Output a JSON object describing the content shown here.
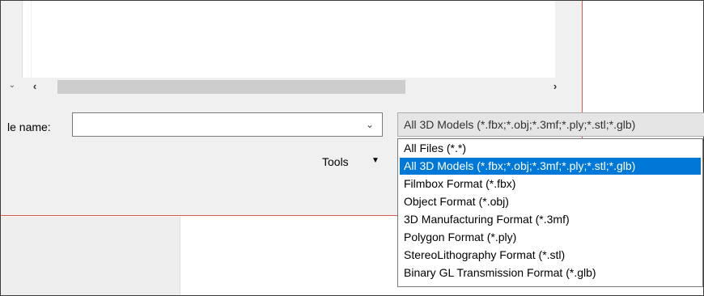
{
  "dialog": {
    "file_name_label": "le name:",
    "file_name_value": "",
    "file_type_selected": "All 3D Models (*.fbx;*.obj;*.3mf;*.ply;*.stl;*.glb)",
    "tools_label": "Tools"
  },
  "icons": {
    "tree_expand": "chevron-down-icon",
    "scroll_left": "scroll-left-arrow-icon",
    "scroll_right": "scroll-right-arrow-icon",
    "filename_dropdown": "chevron-down-icon",
    "tools_menu": "caret-down-icon"
  },
  "file_type_options": [
    {
      "label": "All Files (*.*)",
      "selected": false
    },
    {
      "label": "All 3D Models (*.fbx;*.obj;*.3mf;*.ply;*.stl;*.glb)",
      "selected": true
    },
    {
      "label": "Filmbox Format (*.fbx)",
      "selected": false
    },
    {
      "label": "Object Format (*.obj)",
      "selected": false
    },
    {
      "label": "3D Manufacturing Format (*.3mf)",
      "selected": false
    },
    {
      "label": "Polygon Format (*.ply)",
      "selected": false
    },
    {
      "label": "StereoLithography Format (*.stl)",
      "selected": false
    },
    {
      "label": "Binary GL Transmission Format (*.glb)",
      "selected": false
    }
  ],
  "colors": {
    "selection": "#0078d7",
    "dialog_accent_border": "#d9594f"
  }
}
